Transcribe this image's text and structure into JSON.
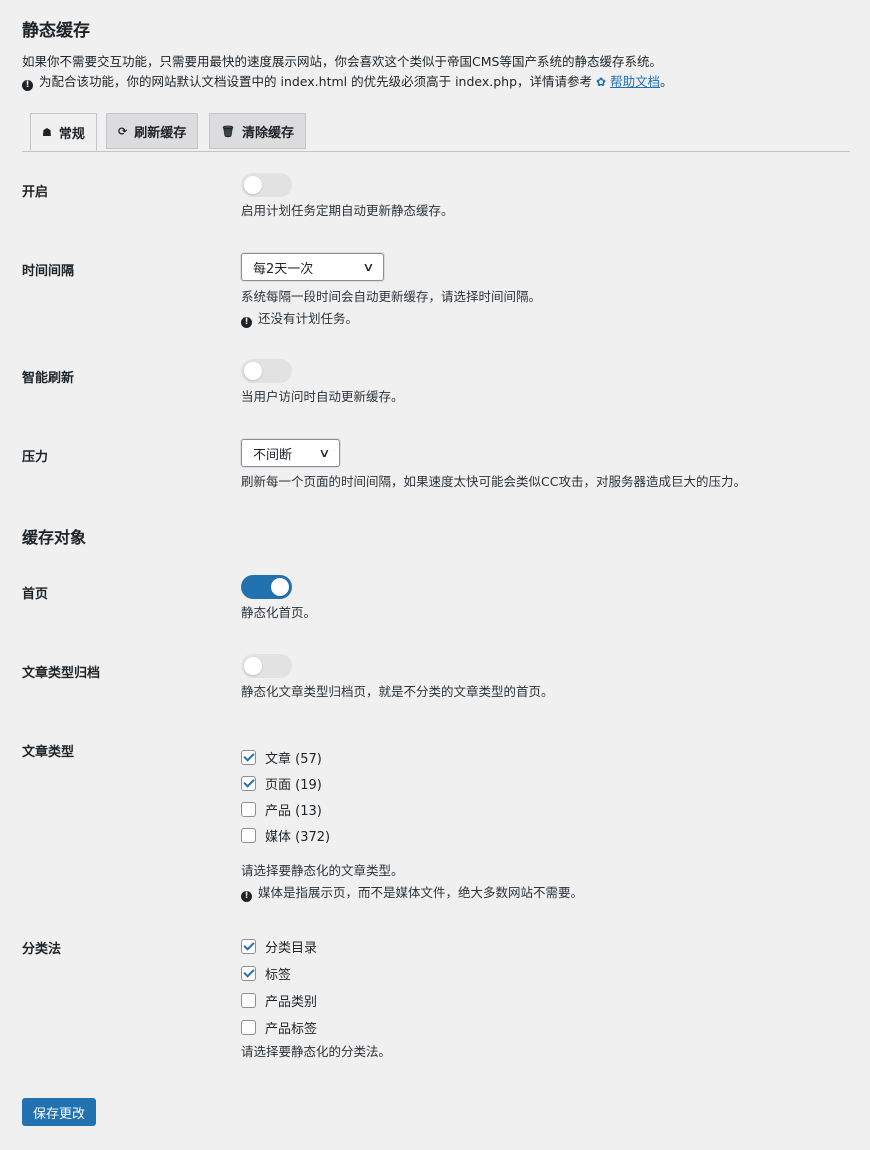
{
  "page": {
    "title": "静态缓存",
    "intro_line1": "如果你不需要交互功能，只需要用最快的速度展示网站，你会喜欢这个类似于帝国CMS等国产系统的静态缓存系统。",
    "intro_line2": "为配合该功能，你的网站默认文档设置中的 index.html 的优先级必须高于 index.php，详情请参考",
    "help_link": "帮助文档",
    "intro_end": "。"
  },
  "tabs": [
    {
      "label": "常规",
      "icon": "dashboard-icon",
      "active": true
    },
    {
      "label": "刷新缓存",
      "icon": "refresh-icon",
      "active": false
    },
    {
      "label": "清除缓存",
      "icon": "trash-icon",
      "active": false
    }
  ],
  "settings": {
    "enable": {
      "label": "开启",
      "on": false,
      "desc": "启用计划任务定期自动更新静态缓存。"
    },
    "interval": {
      "label": "时间间隔",
      "value": "每2天一次",
      "desc": "系统每隔一段时间会自动更新缓存，请选择时间间隔。",
      "note": "还没有计划任务。"
    },
    "smart_refresh": {
      "label": "智能刷新",
      "on": false,
      "desc": "当用户访问时自动更新缓存。"
    },
    "pressure": {
      "label": "压力",
      "value": "不间断",
      "desc": "刷新每一个页面的时间间隔，如果速度太快可能会类似CC攻击，对服务器造成巨大的压力。"
    }
  },
  "cache_objects": {
    "heading": "缓存对象",
    "home": {
      "label": "首页",
      "on": true,
      "desc": "静态化首页。"
    },
    "archive": {
      "label": "文章类型归档",
      "on": false,
      "desc": "静态化文章类型归档页，就是不分类的文章类型的首页。"
    },
    "post_types": {
      "label": "文章类型",
      "items": [
        {
          "label": "文章 (57)",
          "checked": true
        },
        {
          "label": "页面 (19)",
          "checked": true
        },
        {
          "label": "产品 (13)",
          "checked": false
        },
        {
          "label": "媒体 (372)",
          "checked": false
        }
      ],
      "desc": "请选择要静态化的文章类型。",
      "note": "媒体是指展示页，而不是媒体文件，绝大多数网站不需要。"
    },
    "taxonomies": {
      "label": "分类法",
      "items": [
        {
          "label": "分类目录",
          "checked": true
        },
        {
          "label": "标签",
          "checked": true
        },
        {
          "label": "产品类别",
          "checked": false
        },
        {
          "label": "产品标签",
          "checked": false
        }
      ],
      "desc": "请选择要静态化的分类法。"
    }
  },
  "save_label": "保存更改",
  "colors": {
    "accent": "#2271b1",
    "background": "#f0f0f1",
    "text": "#1d2327"
  }
}
